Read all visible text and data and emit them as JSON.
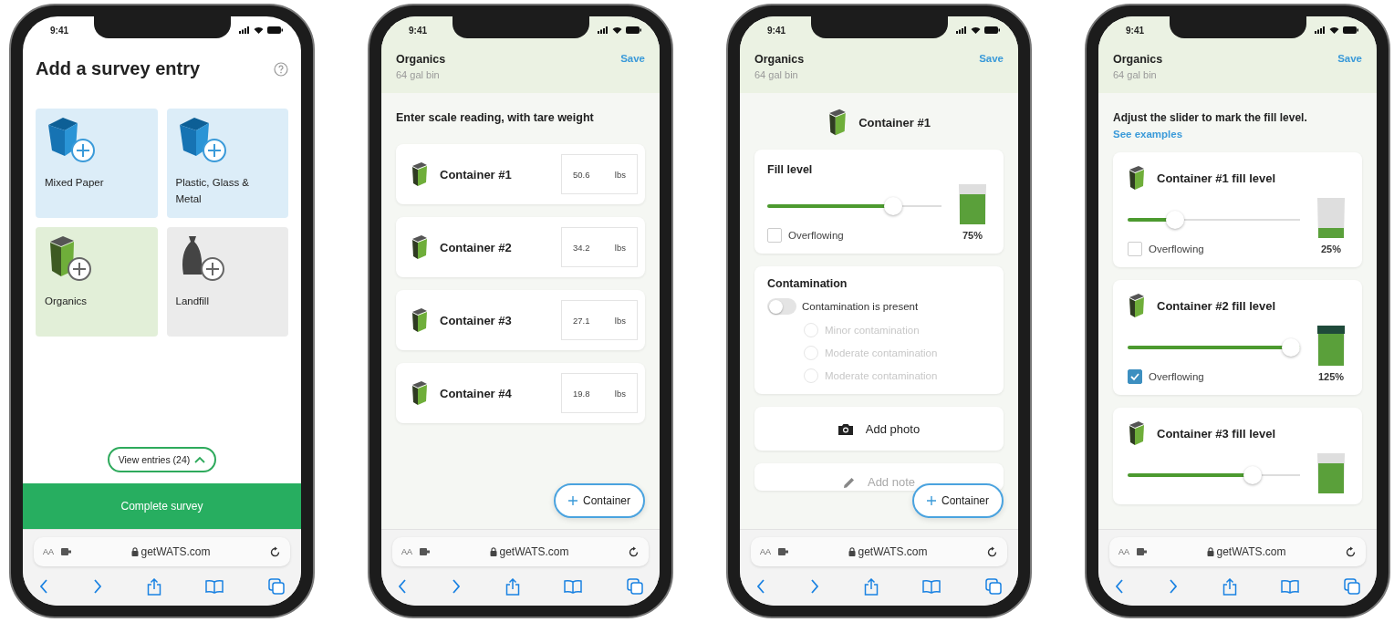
{
  "phones": [
    {
      "kind": "survey-menu",
      "time": "9:41",
      "title": "Add a survey entry",
      "tiles": [
        {
          "label": "Mixed Paper",
          "kind": "blue-bin",
          "color": "#dcedf8"
        },
        {
          "label": "Plastic, Glass & Metal",
          "kind": "blue-bin",
          "color": "#dcedf8"
        },
        {
          "label": "Organics",
          "kind": "green-bin",
          "color": "#e2efd8"
        },
        {
          "label": "Landfill",
          "kind": "bag",
          "color": "#ebebeb"
        }
      ],
      "view_entries": "View entries (24)",
      "complete_button": "Complete survey",
      "browser": {
        "text_size": "AA",
        "url": "getWATS.com"
      }
    },
    {
      "kind": "scale-readings",
      "time": "9:41",
      "header": {
        "title": "Organics",
        "subtitle": "64 gal bin",
        "action": "Save"
      },
      "instruction": "Enter scale reading, with tare weight",
      "containers": [
        {
          "name": "Container #1",
          "value": "50.6",
          "unit": "lbs"
        },
        {
          "name": "Container #2",
          "value": "34.2",
          "unit": "lbs"
        },
        {
          "name": "Container #3",
          "value": "27.1",
          "unit": "lbs"
        },
        {
          "name": "Container #4",
          "value": "19.8",
          "unit": "lbs"
        }
      ],
      "add_button": "Container",
      "browser": {
        "text_size": "AA",
        "url": "getWATS.com"
      }
    },
    {
      "kind": "container-detail",
      "time": "9:41",
      "header": {
        "title": "Organics",
        "subtitle": "64 gal bin",
        "action": "Save"
      },
      "container": "Container #1",
      "fill": {
        "title": "Fill level",
        "level": 0.75,
        "reading": "75%",
        "overflowing": false,
        "overflow_label": "Overflowing"
      },
      "contamination": {
        "title": "Contamination",
        "on": false,
        "toggle_label": "Contamination is present",
        "options": [
          {
            "label": "Minor contamination",
            "selected": false,
            "disabled": true
          },
          {
            "label": "Moderate contamination",
            "selected": false,
            "disabled": true
          },
          {
            "label": "Moderate contamination",
            "selected": false,
            "disabled": true
          }
        ]
      },
      "actions": [
        {
          "label": "Add photo",
          "kind": "photo"
        },
        {
          "label": "Add note",
          "kind": "note"
        }
      ],
      "add_button": "Container",
      "browser": {
        "text_size": "AA",
        "url": "getWATS.com"
      }
    },
    {
      "kind": "fill-levels",
      "time": "9:41",
      "header": {
        "title": "Organics",
        "subtitle": "64 gal bin",
        "action": "Save"
      },
      "instruction": "Adjust the slider to mark the fill level.",
      "link": "See examples",
      "containers": [
        {
          "title": "Container #1 fill level",
          "level": 0.25,
          "reading": "25%",
          "overflowing": false,
          "overflow_label": "Overflowing"
        },
        {
          "title": "Container #2 fill level",
          "level": 1,
          "reading": "125%",
          "overflowing": true,
          "overflow_label": "Overflowing"
        },
        {
          "title": "Container #3 fill level",
          "level": 0.75
        }
      ],
      "browser": {
        "text_size": "AA",
        "url": "getWATS.com"
      }
    }
  ]
}
